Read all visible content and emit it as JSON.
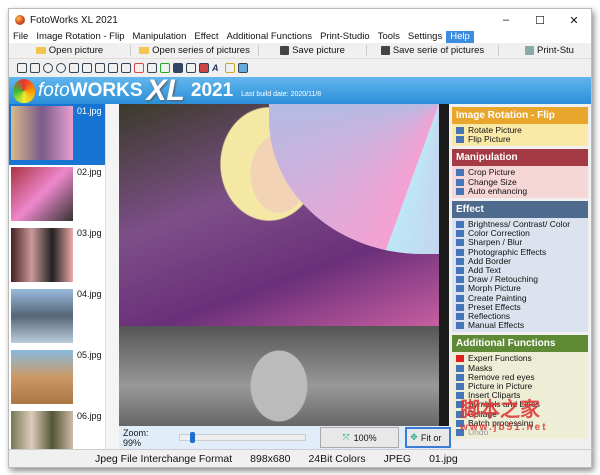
{
  "title": "FotoWorks XL 2021",
  "window_controls": {
    "minimize": "–",
    "maximize": "☐",
    "close": "✕"
  },
  "menu": [
    "File",
    "Image Rotation - Flip",
    "Manipulation",
    "Effect",
    "Additional Functions",
    "Print-Studio",
    "Tools",
    "Settings",
    "Help"
  ],
  "toolbar": {
    "open": "Open picture",
    "open_series": "Open series of pictures",
    "save": "Save picture",
    "save_series": "Save serie of pictures",
    "print": "Print-Stu"
  },
  "banner": {
    "foto": "foto",
    "works": "WORKS",
    "xl": "XL",
    "year": "2021",
    "build": "Last build date: 2020/11/8"
  },
  "thumbnails": [
    "01.jpg",
    "02.jpg",
    "03.jpg",
    "04.jpg",
    "05.jpg",
    "06.jpg"
  ],
  "zoom": {
    "label": "Zoom: 99%",
    "value": 99,
    "btn100": "100%",
    "fit": "Fit or"
  },
  "panel": [
    {
      "title": "Image Rotation - Flip",
      "color": "#e8a62c",
      "bg": "#fbe9a8",
      "items": [
        "Rotate Picture",
        "Flip Picture"
      ]
    },
    {
      "title": "Manipulation",
      "color": "#a33a44",
      "bg": "#f6d7d7",
      "items": [
        "Crop Picture",
        "Change Size",
        "Auto enhancing"
      ]
    },
    {
      "title": "Effect",
      "color": "#4e6a8c",
      "bg": "#dde3ee",
      "items": [
        "Brightness/ Contrast/ Color",
        "Color Correction",
        "Sharpen / Blur",
        "Photographic Effects",
        "Add Border",
        "Add Text",
        "Draw / Retouching",
        "Morph Picture",
        "Create Painting",
        "Preset Effects",
        "Reflections",
        "Manual Effects"
      ]
    },
    {
      "title": "Additional Functions",
      "color": "#5e8a36",
      "bg": "#eeeed6",
      "items": [
        "Expert Functions",
        "Masks",
        "Remove red eyes",
        "Picture in Picture",
        "Insert Cliparts",
        "Symbols and Lines",
        "Collage",
        "Batch processing",
        "Undo"
      ]
    }
  ],
  "status": [
    "Jpeg File Interchange Format",
    "898x680",
    "24Bit Colors",
    "JPEG",
    "01.jpg"
  ],
  "watermark": {
    "cn": "脚本之家",
    "url": "www.jb51.net"
  }
}
